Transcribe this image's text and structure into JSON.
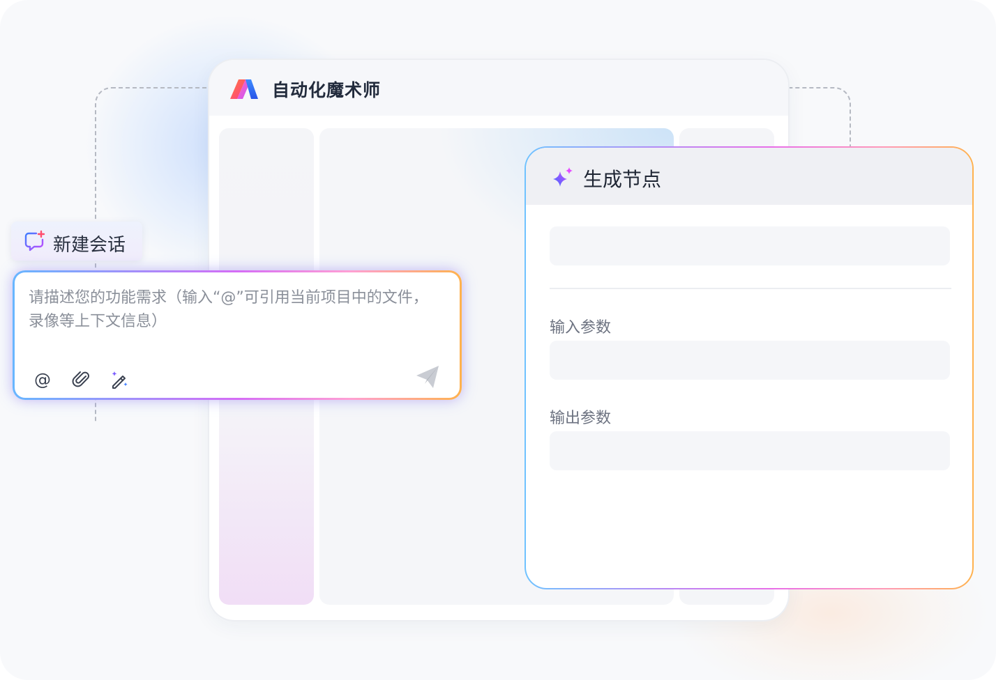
{
  "app": {
    "title": "自动化魔术师",
    "logo_icon": "app-logo-icon",
    "colors": {
      "logo_red": "#ff5a3c",
      "logo_pink": "#ff4fa3",
      "logo_blue": "#2f6bff"
    }
  },
  "new_chat": {
    "label": "新建会话",
    "icon": "chat-plus-icon"
  },
  "composer": {
    "placeholder": "请描述您的功能需求（输入“@”可引用当前项目中的文件，录像等上下文信息）",
    "tools": [
      {
        "name": "mention-icon",
        "glyph": "@"
      },
      {
        "name": "attach-icon"
      },
      {
        "name": "magic-wand-icon"
      }
    ],
    "send_icon": "send-icon"
  },
  "node_card": {
    "title": "生成节点",
    "sparkle_icon": "sparkle-icon",
    "fields": {
      "input_label": "输入参数",
      "output_label": "输出参数"
    },
    "colors": {
      "border_start": "#d36df3",
      "border_end": "#ffb24d"
    }
  }
}
